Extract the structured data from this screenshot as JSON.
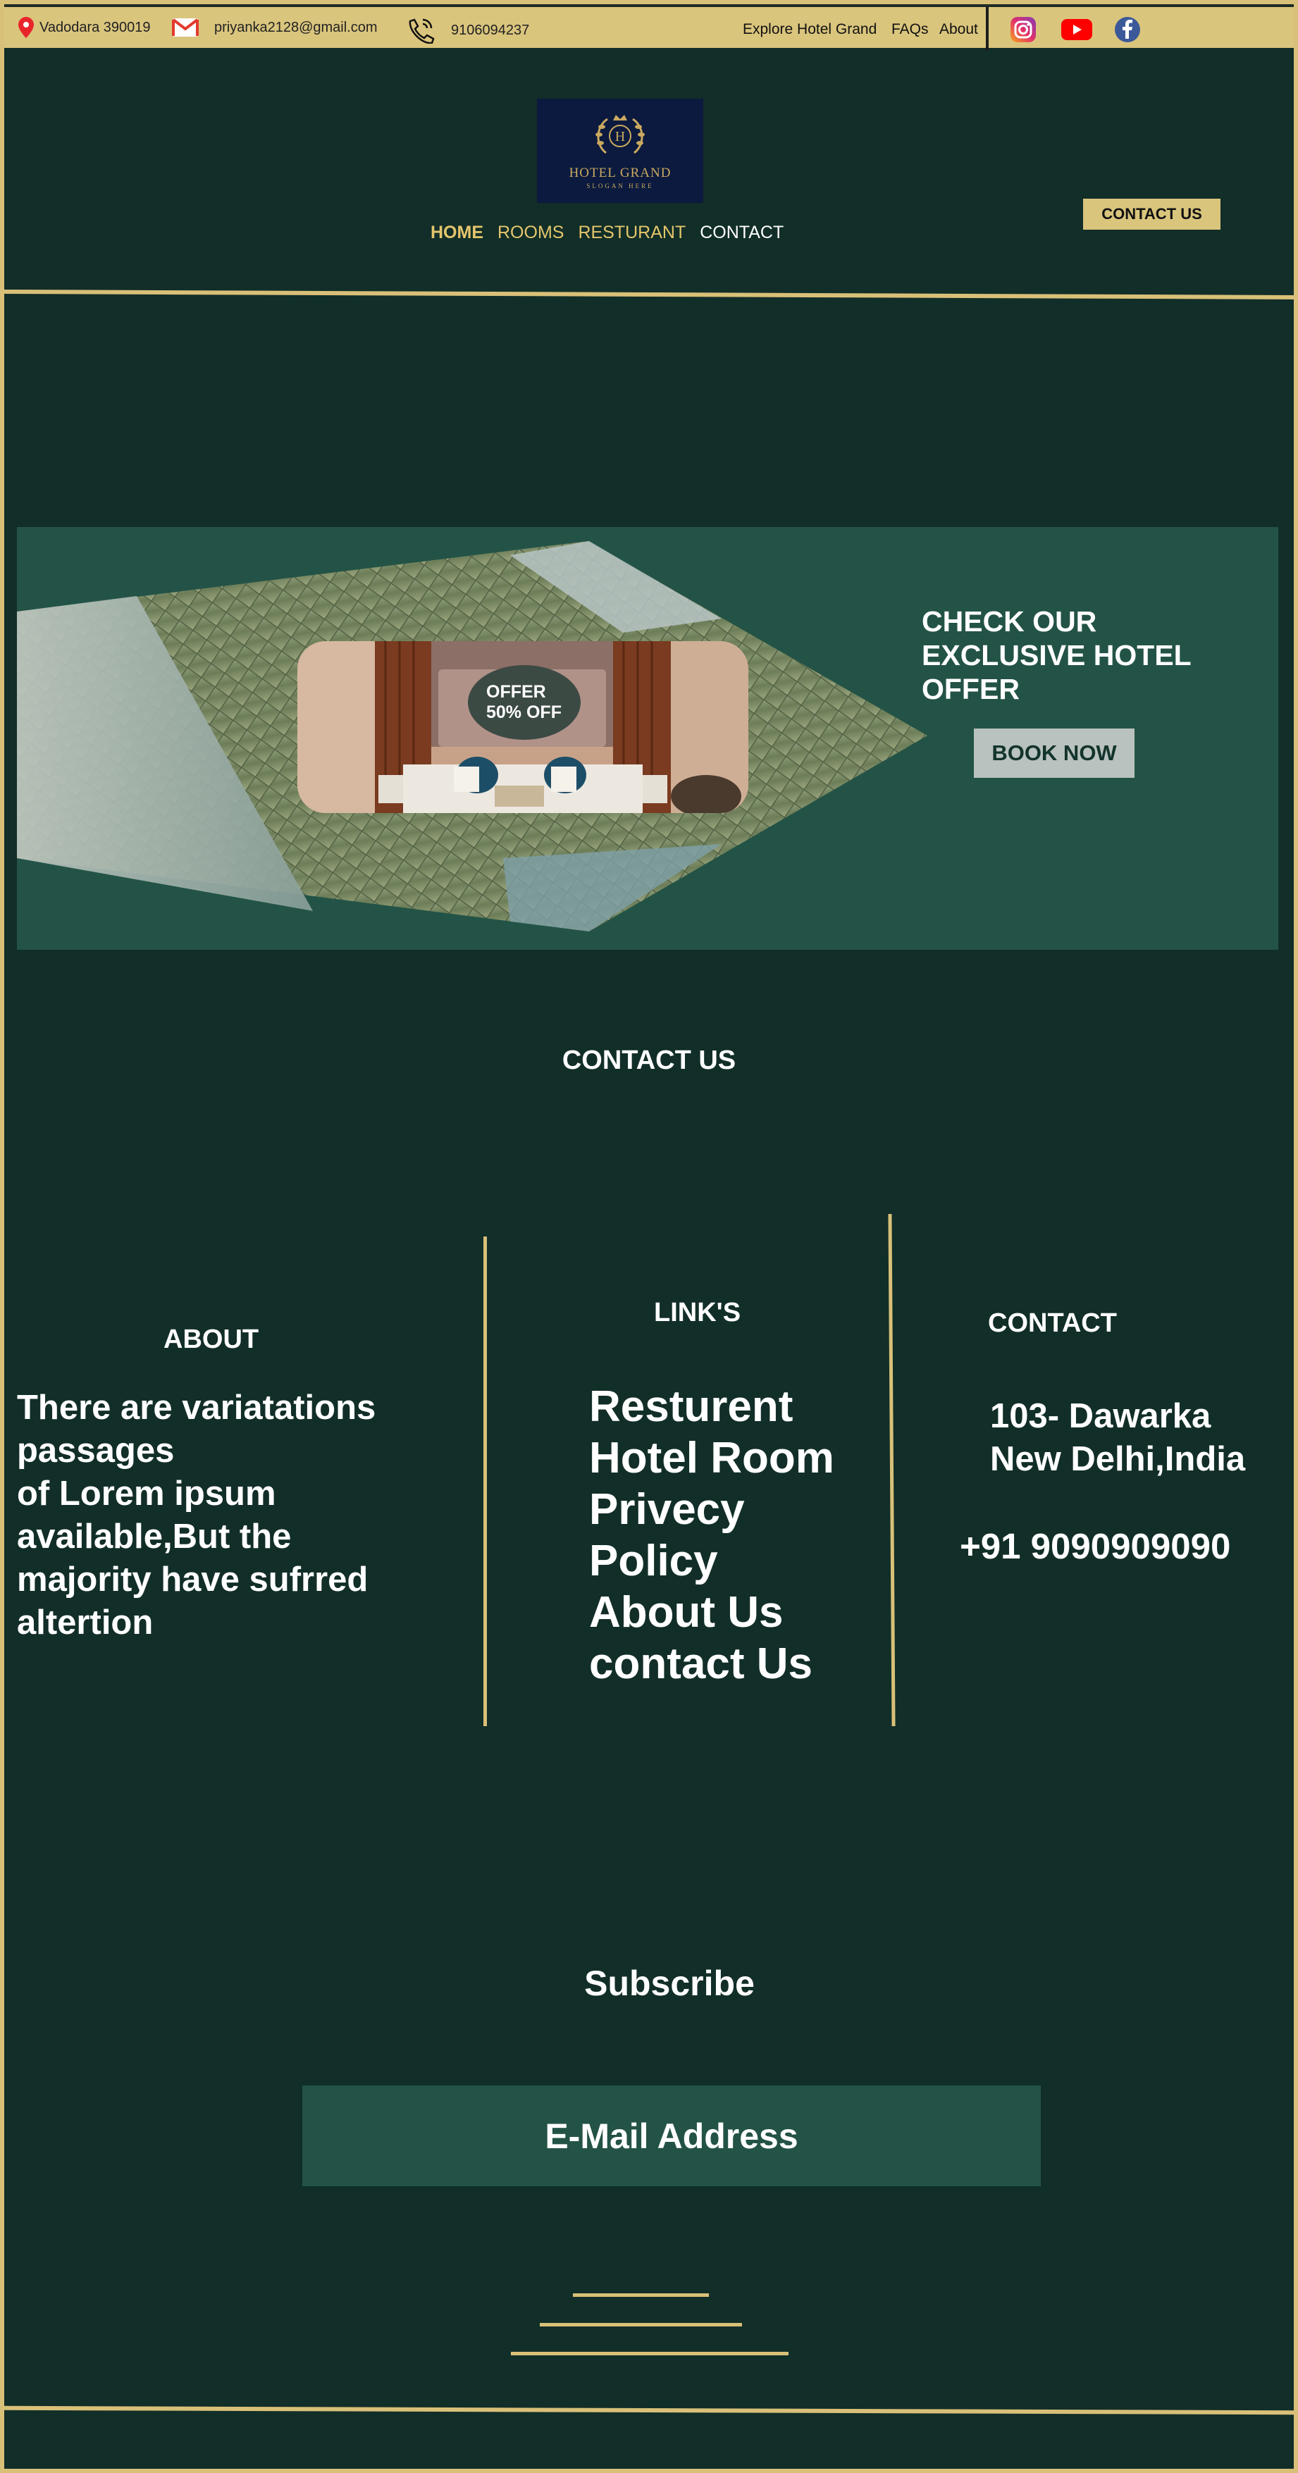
{
  "topbar": {
    "location": "Vadodara 390019",
    "email": "priyanka2128@gmail.com",
    "phone": "9106094237",
    "links": [
      "Explore Hotel Grand",
      "FAQs",
      "About"
    ],
    "social_icons": [
      "instagram-icon",
      "youtube-icon",
      "facebook-icon"
    ]
  },
  "logo": {
    "monogram": "H",
    "name": "HOTEL GRAND",
    "slogan": "SLOGAN HERE"
  },
  "nav": {
    "items": [
      "HOME",
      "ROOMS",
      "RESTURANT",
      "CONTACT"
    ],
    "active": "HOME",
    "contact_button": "CONTACT US"
  },
  "hero": {
    "offer_line1": "OFFER",
    "offer_line2": "50% OFF",
    "title": "CHECK OUR EXCLUSIVE HOTEL OFFER",
    "button": "BOOK NOW"
  },
  "contact_section": {
    "heading": "CONTACT US"
  },
  "footer": {
    "about_title": "ABOUT",
    "about_text": "There are variatations\npassages\nof Lorem ipsum\navailable,But  the\nmajority  have sufrred\naltertion",
    "links_title": "LINK'S",
    "links": [
      "Resturent",
      "Hotel Room",
      "Privecy",
      "Policy",
      "About Us",
      "contact Us"
    ],
    "contact_title": "CONTACT",
    "address": "103- Dawarka\nNew Delhi,India",
    "phone": "+91 9090909090"
  },
  "subscribe": {
    "title": "Subscribe",
    "placeholder": "E-Mail Address"
  },
  "colors": {
    "background": "#122e28",
    "gold": "#d9c078",
    "panel": "#235346"
  }
}
